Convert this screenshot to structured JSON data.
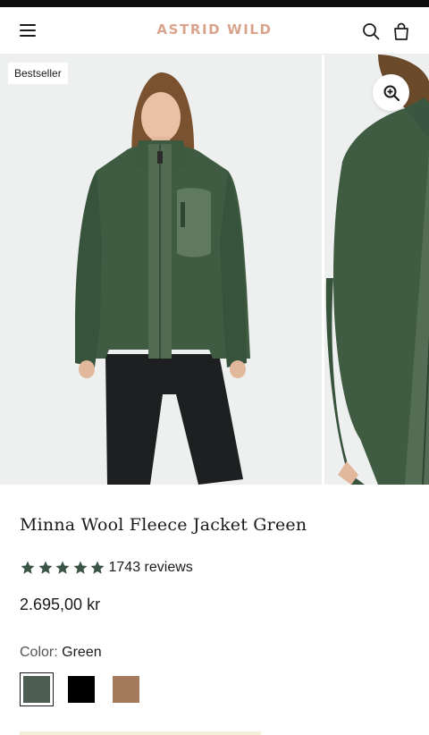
{
  "header": {
    "logo": "ASTRID WILD",
    "menu_icon": "hamburger-menu-icon",
    "search_icon": "search-icon",
    "cart_icon": "shopping-bag-icon",
    "logo_color": "#d9a48e"
  },
  "gallery": {
    "badge": "Bestseller",
    "zoom_icon": "zoom-in-icon"
  },
  "product": {
    "title": "Minna Wool Fleece Jacket Green",
    "rating_stars": 5,
    "reviews": "1743 reviews",
    "price": "2.695,00 kr",
    "color_label": "Color:",
    "color_value": "Green",
    "swatches": [
      {
        "name": "Green",
        "color": "#4e5d51",
        "selected": true
      },
      {
        "name": "Black",
        "color": "#000000",
        "selected": false
      },
      {
        "name": "Brown",
        "color": "#a37a5c",
        "selected": false
      }
    ],
    "star_color": "#3a5446"
  }
}
